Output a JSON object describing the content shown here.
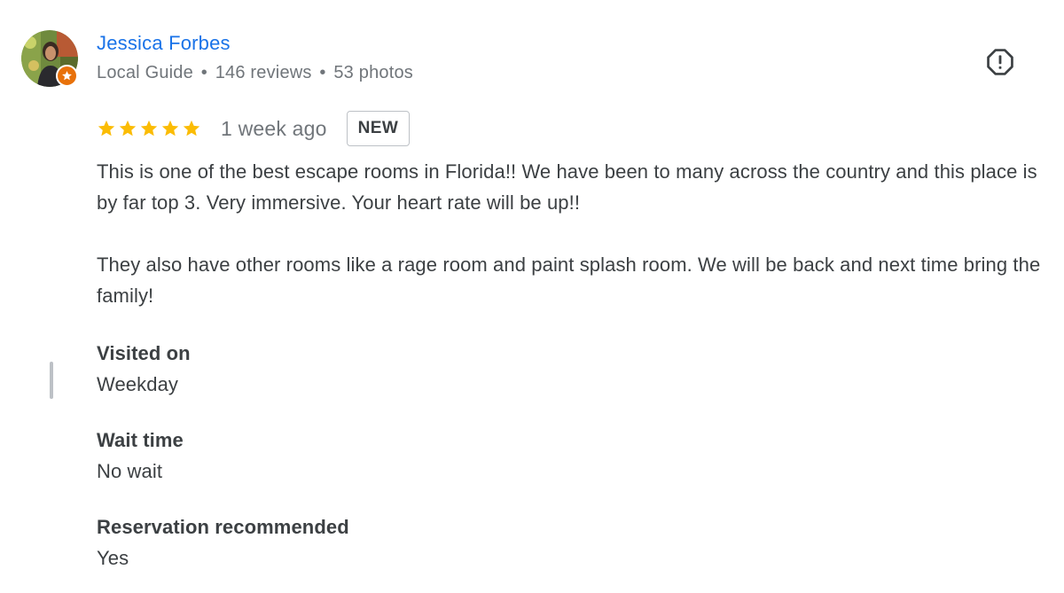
{
  "author": {
    "name": "Jessica Forbes",
    "level": "Local Guide",
    "separator": "•",
    "reviews": "146 reviews",
    "photos": "53 photos",
    "avatar_icon": "profile-photo",
    "badge_icon": "local-guide-star-icon",
    "badge_color": "#e8710a"
  },
  "report_icon": "report-octagon-icon",
  "review": {
    "rating": 5,
    "rating_max": 5,
    "star_color": "#fbbc04",
    "time_ago": "1 week ago",
    "badge": "NEW",
    "paragraphs": [
      "This is one of the best escape rooms in Florida!! We have been to many across the country and this place is by far top 3. Very immersive. Your heart rate will be up!!",
      "They also have other rooms like a rage room and paint splash room. We will be back and next time bring the family!"
    ]
  },
  "attributes": [
    {
      "label": "Visited on",
      "value": "Weekday"
    },
    {
      "label": "Wait time",
      "value": "No wait"
    },
    {
      "label": "Reservation recommended",
      "value": "Yes"
    }
  ],
  "colors": {
    "name_link": "#1a73e8",
    "meta_text": "#70757a",
    "body_text": "#3c4043"
  }
}
